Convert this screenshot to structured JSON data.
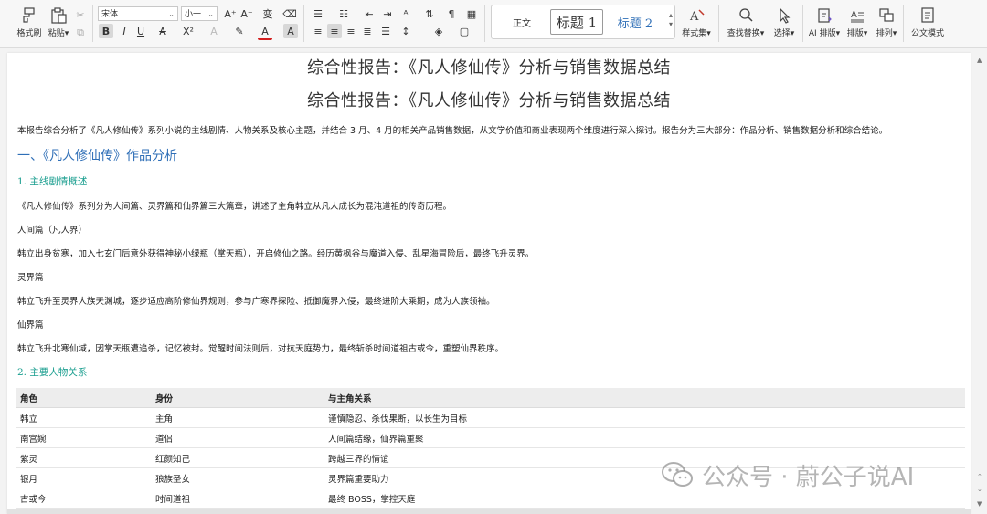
{
  "toolbar": {
    "format_painter": "格式刷",
    "paste": "粘贴",
    "font_name": "宋体",
    "font_size": "小一",
    "styles": {
      "normal": "正文",
      "heading1": "标题 1",
      "heading2": "标题 2"
    },
    "style_set": "样式集",
    "find_replace": "查找替换",
    "select": "选择",
    "ai_layout": "AI 排版",
    "layout": "排版",
    "arrange": "排列",
    "official_mode": "公文模式"
  },
  "document": {
    "title": "综合性报告：《凡人修仙传》分析与销售数据总结",
    "intro": "本报告综合分析了《凡人修仙传》系列小说的主线剧情、人物关系及核心主题，并结合 3 月、4 月的相关产品销售数据，从文学价值和商业表现两个维度进行深入探讨。报告分为三大部分：作品分析、销售数据分析和综合结论。",
    "section1": "一、《凡人修仙传》作品分析",
    "sub1": "1. 主线剧情概述",
    "sub1_intro": "《凡人修仙传》系列分为人间篇、灵界篇和仙界篇三大篇章，讲述了主角韩立从凡人成长为混沌道祖的传奇历程。",
    "part1_title": "人间篇（凡人界）",
    "part1_text": "韩立出身贫寒，加入七玄门后意外获得神秘小绿瓶（掌天瓶），开启修仙之路。经历黄枫谷与魔道入侵、乱星海冒险后，最终飞升灵界。",
    "part2_title": "灵界篇",
    "part2_text": "韩立飞升至灵界人族天渊城，逐步适应高阶修仙界规则，参与广寒界探险、抵御魔界入侵，最终进阶大乘期，成为人族领袖。",
    "part3_title": "仙界篇",
    "part3_text": "韩立飞升北寒仙域，因掌天瓶遭追杀，记忆被封。觉醒时间法则后，对抗天庭势力，最终斩杀时间道祖古或今，重塑仙界秩序。",
    "sub2": "2. 主要人物关系",
    "table": {
      "headers": [
        "角色",
        "身份",
        "与主角关系"
      ],
      "rows": [
        [
          "韩立",
          "主角",
          "谨慎隐忍、杀伐果断，以长生为目标"
        ],
        [
          "南宫婉",
          "道侣",
          "人间篇结缘，仙界篇重聚"
        ],
        [
          "紫灵",
          "红颜知己",
          "跨越三界的情谊"
        ],
        [
          "银月",
          "狼族圣女",
          "灵界篇重要助力"
        ],
        [
          "古或今",
          "时间道祖",
          "最终 BOSS，掌控天庭"
        ]
      ]
    }
  },
  "watermark": "公众号 · 蔚公子说AI"
}
